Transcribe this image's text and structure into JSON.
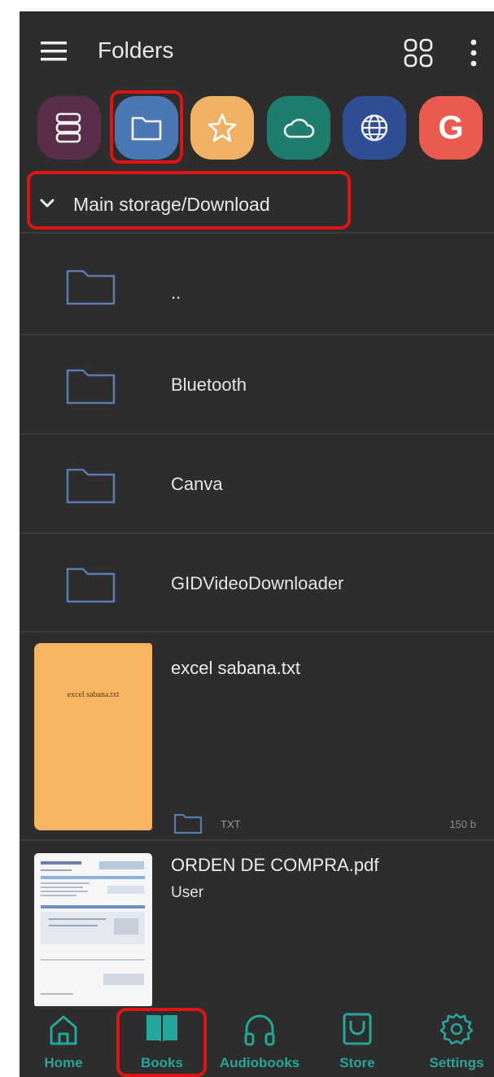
{
  "header": {
    "title": "Folders"
  },
  "header_icons": [
    "menu-icon",
    "grid-view-icon",
    "more-vert-icon"
  ],
  "source_chips": [
    {
      "name": "library-icon",
      "color": "#5a2e4a"
    },
    {
      "name": "folder-icon",
      "color": "#4b78b4",
      "selected": true
    },
    {
      "name": "star-icon",
      "color": "#f1b165"
    },
    {
      "name": "cloud-icon",
      "color": "#1e7d6c"
    },
    {
      "name": "globe-icon",
      "color": "#2f4e96"
    },
    {
      "name": "google-icon",
      "color": "#eb5a4f",
      "label": "G"
    }
  ],
  "path": {
    "label": "Main storage/Download"
  },
  "folders": [
    {
      "name": ".."
    },
    {
      "name": "Bluetooth"
    },
    {
      "name": "Canva"
    },
    {
      "name": "GIDVideoDownloader"
    }
  ],
  "files": [
    {
      "name": "excel sabana.txt",
      "cover_text": "excel sabana.txt",
      "type": "TXT",
      "size": "150 b",
      "cover_color": "#f7b561"
    },
    {
      "name": "ORDEN DE COMPRA.pdf",
      "author": "User"
    }
  ],
  "bottom_nav": [
    {
      "label": "Home",
      "icon": "home-icon"
    },
    {
      "label": "Books",
      "icon": "book-icon",
      "active": true
    },
    {
      "label": "Audiobooks",
      "icon": "headphones-icon"
    },
    {
      "label": "Store",
      "icon": "store-icon"
    },
    {
      "label": "Settings",
      "icon": "gear-icon"
    }
  ],
  "colors": {
    "background": "#2d2d2d",
    "accent": "#25a69a",
    "highlight": "#e21313",
    "folder_outline": "#5a7bb0"
  }
}
